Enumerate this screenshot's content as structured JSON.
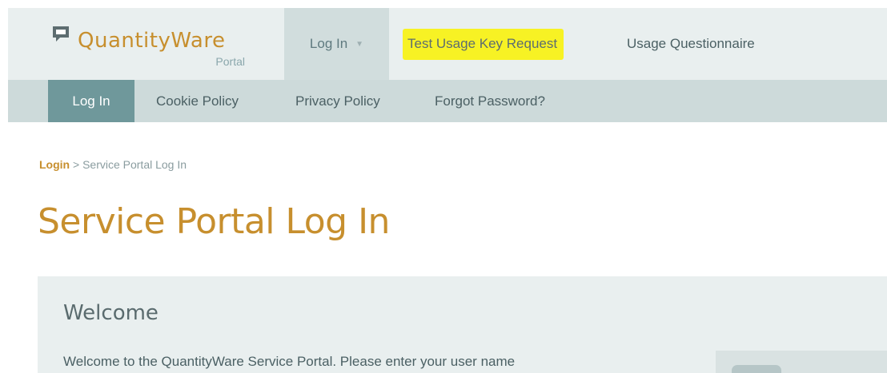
{
  "header": {
    "logo": {
      "name": "QuantityWare",
      "subtitle": "Portal",
      "icon": "speech-bubble-icon"
    },
    "nav": {
      "login_label": "Log In",
      "login_caret": "▼",
      "test_key_label": "Test Usage Key Request",
      "questionnaire_label": "Usage Questionnaire"
    }
  },
  "subnav": {
    "items": [
      {
        "label": "Log In",
        "active": true
      },
      {
        "label": "Cookie Policy",
        "active": false
      },
      {
        "label": "Privacy Policy",
        "active": false
      },
      {
        "label": "Forgot Password?",
        "active": false
      }
    ]
  },
  "breadcrumb": {
    "link": "Login",
    "separator": ">",
    "current": "Service Portal Log In"
  },
  "page": {
    "title": "Service Portal Log In"
  },
  "welcome": {
    "title": "Welcome",
    "text": "Welcome to the QuantityWare Service Portal. Please enter your user name"
  },
  "colors": {
    "brand_gold": "#c78f2e",
    "active_teal": "#6f989b",
    "highlight_yellow": "#f7f224"
  }
}
